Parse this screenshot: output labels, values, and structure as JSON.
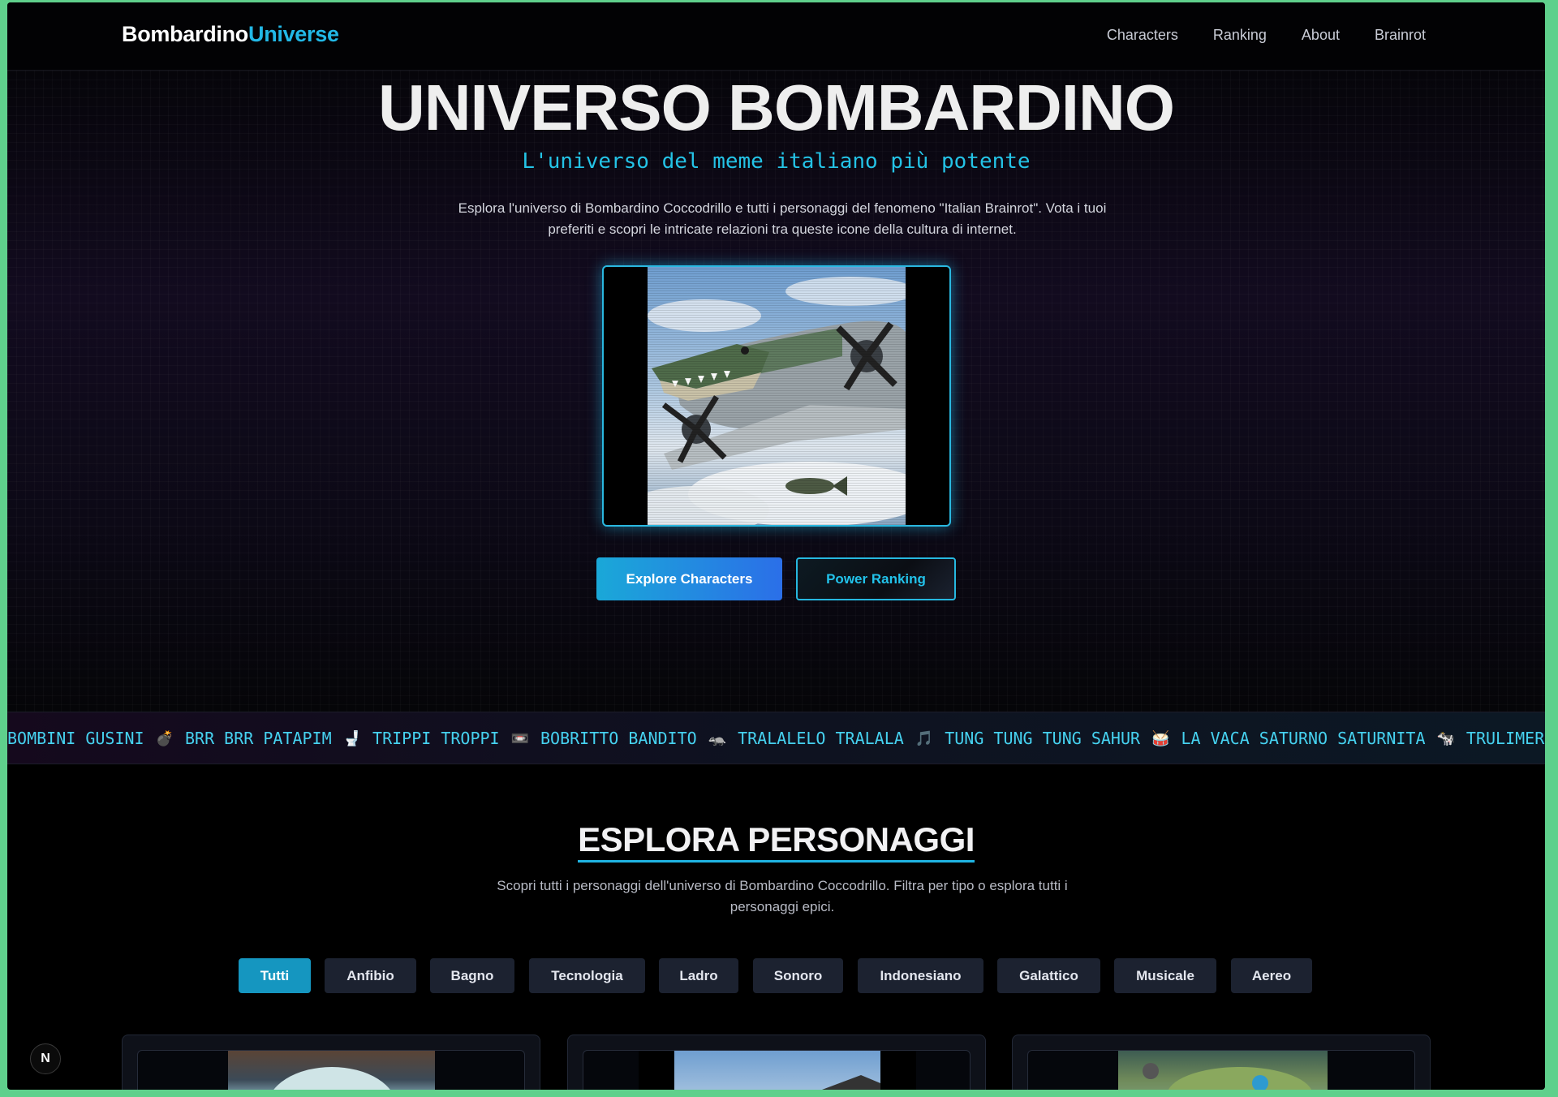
{
  "nav": {
    "brand_part1": "Bombardino",
    "brand_part2": "Universe",
    "links": [
      "Characters",
      "Ranking",
      "About",
      "Brainrot"
    ]
  },
  "hero": {
    "title": "UNIVERSO BOMBARDINO",
    "subtitle": "L'universo del meme italiano più potente",
    "description": "Esplora l'universo di Bombardino Coccodrillo e tutti i personaggi del fenomeno \"Italian Brainrot\". Vota i tuoi preferiti e scopri le intricate relazioni tra queste icone della cultura di internet.",
    "primary_button": "Explore Characters",
    "secondary_button": "Power Ranking"
  },
  "ticker": {
    "items": [
      {
        "text": "BOMBINI GUSINI",
        "emoji": "💣"
      },
      {
        "text": "BRR BRR PATAPIM",
        "emoji": "🚽"
      },
      {
        "text": "TRIPPI TROPPI",
        "emoji": "📼"
      },
      {
        "text": "BOBRITTO BANDITO",
        "emoji": "🦡"
      },
      {
        "text": "TRALALELO TRALALA",
        "emoji": "🎵"
      },
      {
        "text": "TUNG TUNG TUNG SAHUR",
        "emoji": "🥁"
      },
      {
        "text": "LA VACA SATURNO SATURNITA",
        "emoji": "🐄"
      },
      {
        "text": "TRULIMERO TRULICINA",
        "emoji": ""
      }
    ]
  },
  "section": {
    "title": "ESPLORA PERSONAGGI",
    "description": "Scopri tutti i personaggi dell'universo di Bombardino Coccodrillo. Filtra per tipo o esplora tutti i personaggi epici."
  },
  "filters": {
    "active": "Tutti",
    "items": [
      "Tutti",
      "Anfibio",
      "Bagno",
      "Tecnologia",
      "Ladro",
      "Sonoro",
      "Indonesiano",
      "Galattico",
      "Musicale",
      "Aereo"
    ]
  },
  "colors": {
    "accent": "#22b8e6",
    "background": "#000000",
    "frame": "#5fd08c"
  },
  "icons": {
    "next_badge": "next-logo-icon"
  }
}
